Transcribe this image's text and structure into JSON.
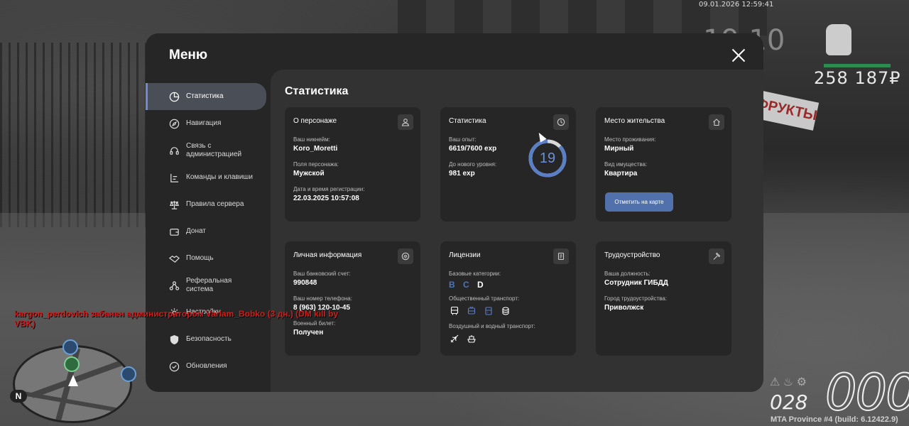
{
  "hud": {
    "datetime": "09.01.2026 12:59:41",
    "clock": "19:10",
    "money": "258 187₽",
    "speed": "000",
    "fuel": "028",
    "build": "MTA Province #4 (build: 6.12422.9)",
    "sign_text": "ФРУКТЫ"
  },
  "chat": {
    "message": "kargon_perdovich забанен администратором Varlam_Bobko (3 дн.) (DM kill by VBK)"
  },
  "menu": {
    "title": "Меню",
    "sidebar": [
      {
        "label": "Статистика",
        "icon": "pie-chart-icon",
        "active": true
      },
      {
        "label": "Навигация",
        "icon": "compass-icon",
        "active": false
      },
      {
        "label": "Связь с администрацией",
        "icon": "headset-icon",
        "active": false
      },
      {
        "label": "Команды и клавиши",
        "icon": "keyboard-icon",
        "active": false
      },
      {
        "label": "Правила сервера",
        "icon": "scales-icon",
        "active": false
      },
      {
        "label": "Донат",
        "icon": "wallet-icon",
        "active": false
      },
      {
        "label": "Помощь",
        "icon": "handshake-icon",
        "active": false
      },
      {
        "label": "Реферальная система",
        "icon": "referral-icon",
        "active": false
      },
      {
        "label": "Настройки",
        "icon": "gear-icon",
        "active": false
      },
      {
        "label": "Безопасность",
        "icon": "shield-icon",
        "active": false
      },
      {
        "label": "Обновления",
        "icon": "refresh-icon",
        "active": false
      }
    ]
  },
  "stats": {
    "title": "Статистика",
    "character": {
      "title": "О персонаже",
      "nickname_label": "Ваш никнейм:",
      "nickname": "Koro_Moretti",
      "gender_label": "Поля персонажа:",
      "gender": "Мужской",
      "reg_label": "Дата и время регистрации:",
      "reg_date": "22.03.2025 10:57:08"
    },
    "statistics": {
      "title": "Статистика",
      "exp_label": "Ваш опыт:",
      "exp": "6619/7600 exp",
      "next_label": "До нового уровня:",
      "next": "981 exp",
      "level": "19",
      "level_progress": 0.871
    },
    "residence": {
      "title": "Место жительства",
      "place_label": "Место проживания:",
      "place": "Мирный",
      "property_label": "Вид имущества:",
      "property": "Квартира",
      "map_button": "Отметить на карте"
    },
    "personal": {
      "title": "Личная информация",
      "bank_label": "Ваш банковский счет:",
      "bank": "990848",
      "phone_label": "Ваш номер телефона:",
      "phone": "8 (963) 120-10-45",
      "military_label": "Военный билет:",
      "military": "Получен"
    },
    "licenses": {
      "title": "Лицензии",
      "base_label": "Базовые категории:",
      "cat_b": "B",
      "cat_c": "C",
      "cat_d": "D",
      "public_label": "Общественный транспорт:",
      "air_water_label": "Воздушный и водный транспорт:"
    },
    "employment": {
      "title": "Трудоустройство",
      "position_label": "Ваша должность:",
      "position": "Сотрудник ГИБДД",
      "city_label": "Город трудоустройства:",
      "city": "Приволжск"
    }
  }
}
